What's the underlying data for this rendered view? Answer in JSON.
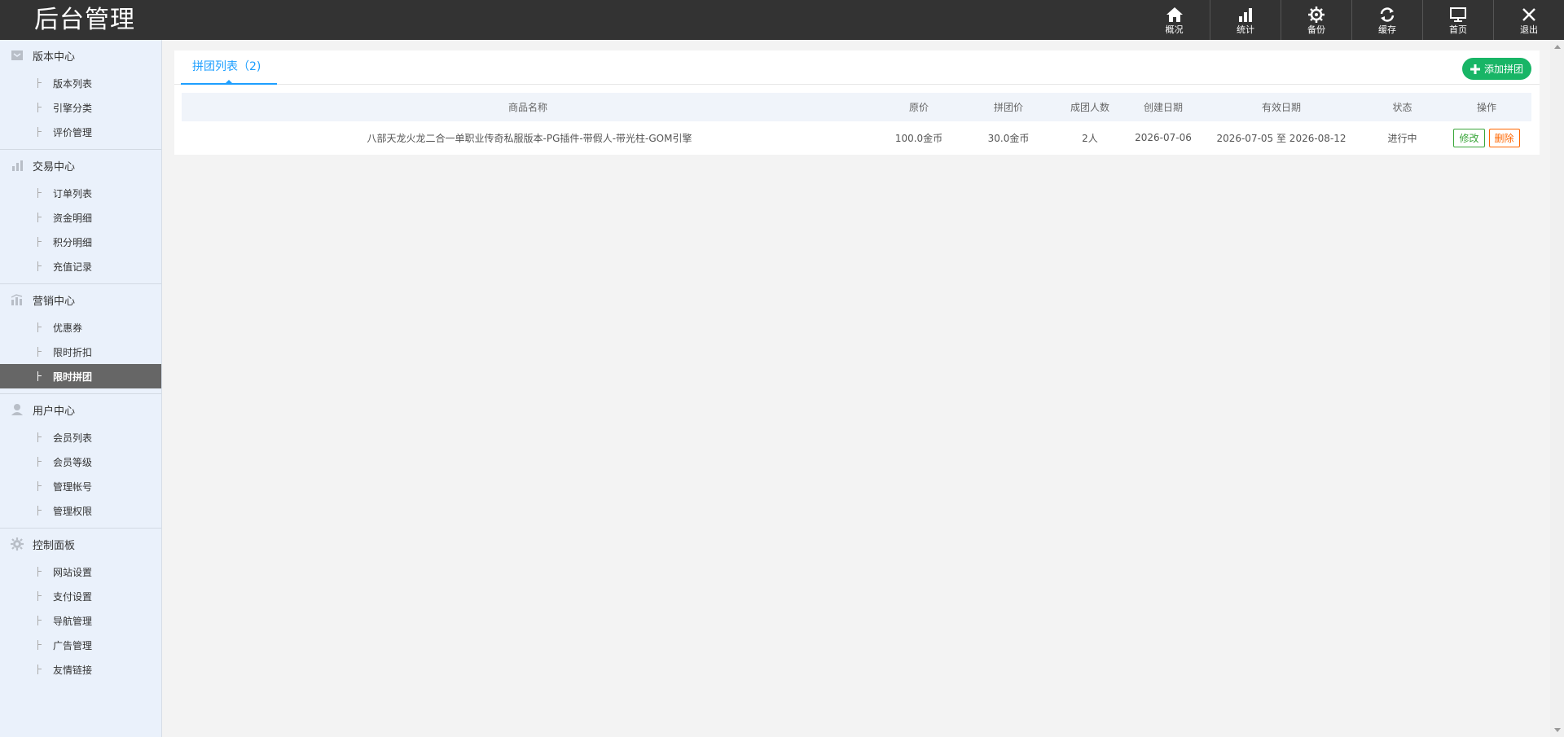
{
  "header": {
    "logo": "后台管理",
    "nav": [
      {
        "label": "概况",
        "icon": "home-icon"
      },
      {
        "label": "统计",
        "icon": "bar-chart-icon"
      },
      {
        "label": "备份",
        "icon": "gear-icon"
      },
      {
        "label": "缓存",
        "icon": "refresh-icon"
      },
      {
        "label": "首页",
        "icon": "monitor-icon"
      },
      {
        "label": "退出",
        "icon": "close-icon"
      }
    ]
  },
  "sidebar": {
    "groups": [
      {
        "title": "版本中心",
        "icon": "box-icon",
        "items": [
          "版本列表",
          "引擎分类",
          "评价管理"
        ]
      },
      {
        "title": "交易中心",
        "icon": "bar-chart-icon",
        "items": [
          "订单列表",
          "资金明细",
          "积分明细",
          "充值记录"
        ]
      },
      {
        "title": "营销中心",
        "icon": "chart-icon",
        "items": [
          "优惠券",
          "限时折扣",
          "限时拼团"
        ]
      },
      {
        "title": "用户中心",
        "icon": "user-icon",
        "items": [
          "会员列表",
          "会员等级",
          "管理帐号",
          "管理权限"
        ]
      },
      {
        "title": "控制面板",
        "icon": "gear-icon",
        "items": [
          "网站设置",
          "支付设置",
          "导航管理",
          "广告管理",
          "友情链接"
        ]
      }
    ],
    "active_item": "限时拼团"
  },
  "main": {
    "tab_label": "拼团列表（2)",
    "add_button": "添加拼团",
    "columns": [
      "商品名称",
      "原价",
      "拼团价",
      "成团人数",
      "创建日期",
      "有效日期",
      "状态",
      "操作"
    ],
    "rows": [
      {
        "name": "八部天龙火龙二合一单职业传奇私服版本-PG插件-带假人-带光柱-GOM引擎",
        "original_price": "100.0金币",
        "group_price": "30.0金币",
        "group_size": "2人",
        "created": "2026-07-06",
        "valid": "2026-07-05 至 2026-08-12",
        "status": "进行中",
        "edit": "修改",
        "delete": "删除"
      }
    ]
  },
  "colors": {
    "header_bg": "#333333",
    "sidebar_bg": "#eaf1fb",
    "accent": "#1e9fff",
    "add_button": "#18b566",
    "price": "#ff6600",
    "status": "#3aa63a"
  }
}
